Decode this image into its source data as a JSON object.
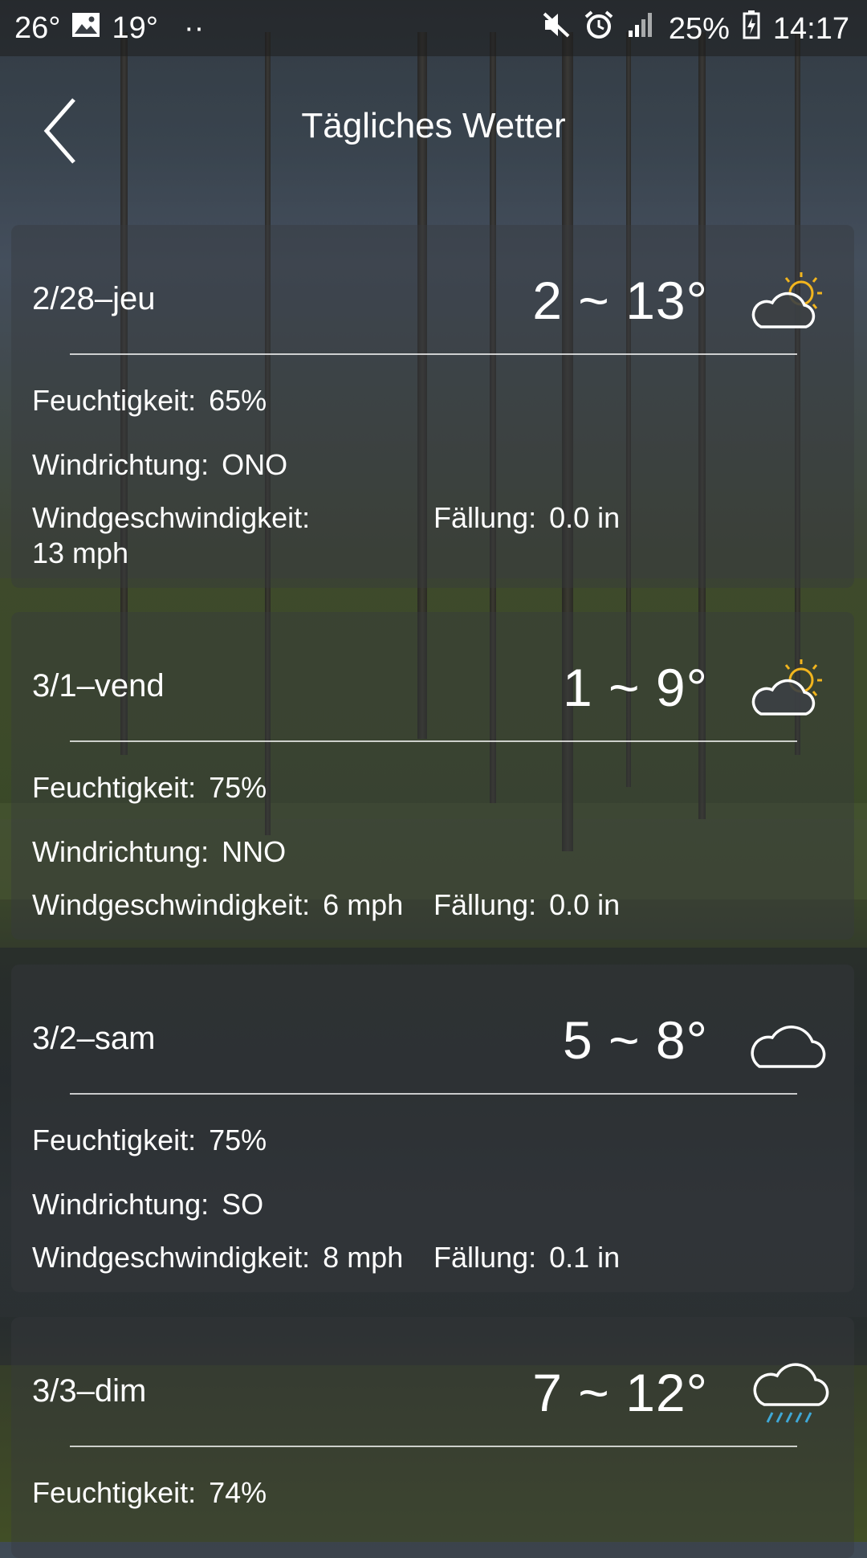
{
  "status_bar": {
    "temp_1": "26°",
    "temp_2": "19°",
    "dots": "··",
    "battery": "25%",
    "time": "14:17"
  },
  "header": {
    "title": "Tägliches Wetter"
  },
  "labels": {
    "humidity": "Feuchtigkeit:",
    "wind_direction": "Windrichtung:",
    "wind_speed": "Windgeschwindigkeit:",
    "precipitation": "Fällung:"
  },
  "days": [
    {
      "date": "2/28–jeu",
      "temp": "2 ~ 13°",
      "icon": "partly-sunny-icon",
      "humidity": "65%",
      "wind_direction": "ONO",
      "wind_speed": "13 mph",
      "precipitation": "0.0 in"
    },
    {
      "date": "3/1–vend",
      "temp": "1 ~ 9°",
      "icon": "partly-sunny-icon",
      "humidity": "75%",
      "wind_direction": "NNO",
      "wind_speed": "6 mph",
      "precipitation": "0.0 in"
    },
    {
      "date": "3/2–sam",
      "temp": "5 ~ 8°",
      "icon": "cloud-icon",
      "humidity": "75%",
      "wind_direction": "SO",
      "wind_speed": "8 mph",
      "precipitation": "0.1 in"
    },
    {
      "date": "3/3–dim",
      "temp": "7 ~ 12°",
      "icon": "rain-icon",
      "humidity": "74%"
    }
  ],
  "colors": {
    "sun": "#f2b51e",
    "rain": "#3fa9d8"
  }
}
